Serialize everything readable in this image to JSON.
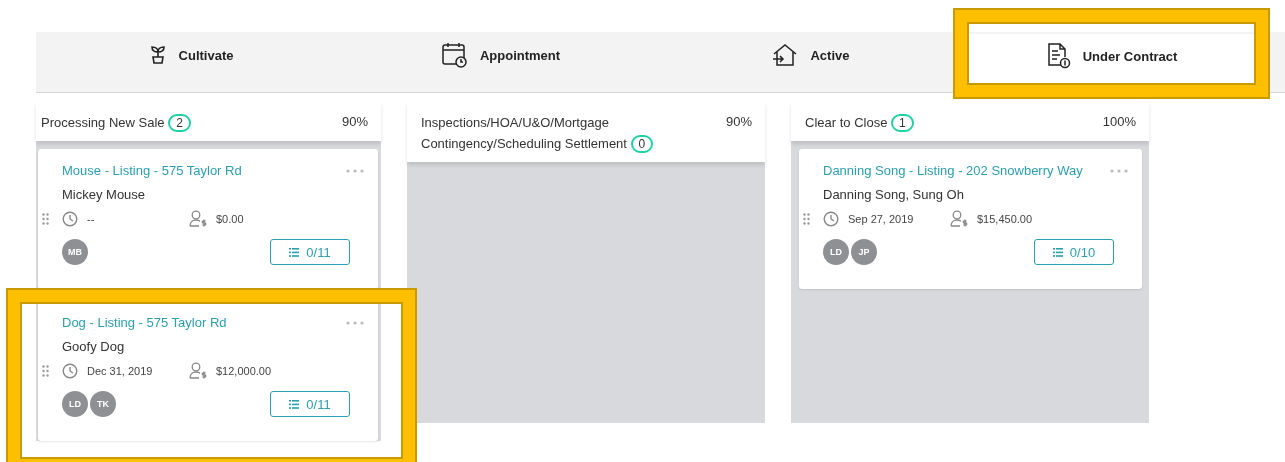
{
  "tabs": [
    {
      "label": "Cultivate",
      "selected": false,
      "highlighted": false
    },
    {
      "label": "Appointment",
      "selected": false,
      "highlighted": false
    },
    {
      "label": "Active",
      "selected": false,
      "highlighted": false
    },
    {
      "label": "Under Contract",
      "selected": true,
      "highlighted": true
    }
  ],
  "columns": [
    {
      "title": "Processing New Sale",
      "count": "2",
      "percent": "90%",
      "cards": [
        {
          "title": "Mouse - Listing - 575 Taylor Rd",
          "clients": "Mickey Mouse",
          "date": "--",
          "amount": "$0.00",
          "agents": [
            "MB"
          ],
          "tasks": "0/11",
          "highlighted": false
        },
        {
          "title": "Dog - Listing - 575 Taylor Rd",
          "clients": "Goofy Dog",
          "date": "Dec 31, 2019",
          "amount": "$12,000.00",
          "agents": [
            "LD",
            "TK"
          ],
          "tasks": "0/11",
          "highlighted": true
        }
      ]
    },
    {
      "title": "Inspections/HOA/U&O/Mortgage Contingency/Scheduling Settlement",
      "count": "0",
      "percent": "90%"
    },
    {
      "title": "Clear to Close",
      "count": "1",
      "percent": "100%",
      "cards": [
        {
          "title": "Danning Song - Listing - 202 Snowberry Way",
          "clients": "Danning Song, Sung Oh",
          "date": "Sep 27, 2019",
          "amount": "$15,450.00",
          "agents": [
            "LD",
            "JP"
          ],
          "tasks": "0/10",
          "highlighted": false
        }
      ]
    }
  ]
}
